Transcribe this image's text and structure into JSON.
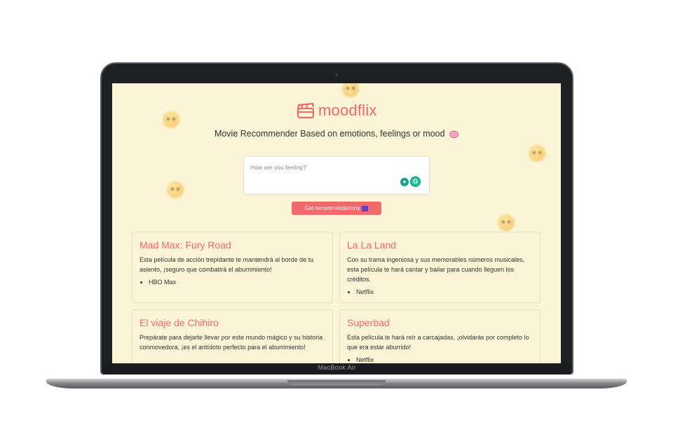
{
  "device": {
    "label": "MacBook Air"
  },
  "app": {
    "brand": "moodflix",
    "brand_color": "#ef6a6a",
    "background": "#fbf4d6",
    "subtitle": "Movie Recommender Based on emotions, feelings or mood",
    "mood_input": {
      "placeholder": "How are you feeling?",
      "value": ""
    },
    "button_label": "Get recommendations",
    "cards": [
      {
        "title": "Mad Max: Fury Road",
        "description": "Esta película de acción trepidante te mantendrá al borde de tu asiento, ¡seguro que combatirá el aburrimiento!",
        "platforms": [
          "HBO Max"
        ]
      },
      {
        "title": "La La Land",
        "description": "Con su trama ingeniosa y sus memorables números musicales, esta película te hará cantar y bailar para cuando lleguen los créditos.",
        "platforms": [
          "Netflix"
        ]
      },
      {
        "title": "El viaje de Chihiro",
        "description": "Prepárate para dejarte llevar por este mundo mágico y su historia conmovedora, ¡es el antídoto perfecto para el aburrimiento!",
        "platforms": []
      },
      {
        "title": "Superbad",
        "description": "Esta película te hará reír a carcajadas, ¡olvidarás por completo lo que era estar aburrido!",
        "platforms": [
          "Netflix"
        ]
      }
    ]
  }
}
